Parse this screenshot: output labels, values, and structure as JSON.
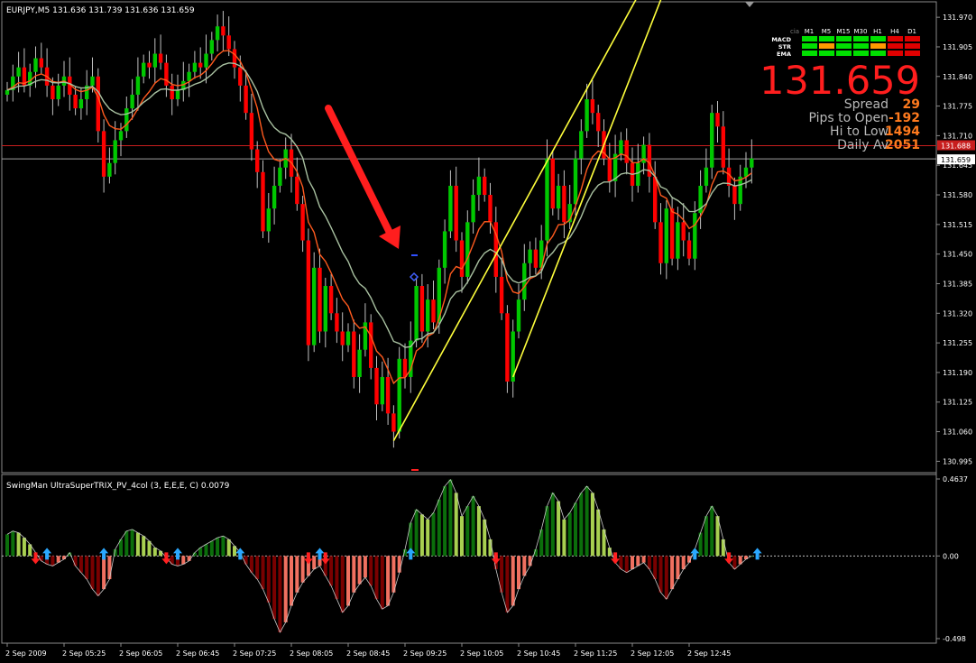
{
  "window": {
    "title": "EURJPY,M5  131.636 131.739 131.636 131.659",
    "indicator_title": "SwingMan UltraSuperTRIX_PV_4col (3, E,E,E, C) 0.0079"
  },
  "colors": {
    "bull": "#00c800",
    "bear": "#ff0000",
    "wick": "#c0c0c0",
    "ema_fast": "#ff5a1e",
    "ema_slow": "#a8c0a0",
    "channel": "#ffff3c",
    "arrow": "#ff1e1e",
    "bid_line": "#c81e1e",
    "ask_line": "#a0a0a0",
    "osc_up_strong": "#0b6e0b",
    "osc_up_weak": "#a8d050",
    "osc_dn_strong": "#7a0000",
    "osc_dn_weak": "#f07060",
    "dash_green": "#00e000",
    "dash_orange": "#ff9a00",
    "dash_red": "#e00000"
  },
  "dashboard": {
    "corner_label": "cia",
    "timeframes": [
      "M1",
      "M5",
      "M15",
      "M30",
      "H1",
      "H4",
      "D1"
    ],
    "rows": [
      {
        "name": "MACD",
        "states": [
          "green",
          "green",
          "green",
          "green",
          "green",
          "red",
          "red"
        ]
      },
      {
        "name": "STR",
        "states": [
          "green",
          "orange",
          "green",
          "green",
          "orange",
          "red",
          "red"
        ]
      },
      {
        "name": "EMA",
        "states": [
          "green",
          "green",
          "green",
          "green",
          "green",
          "red",
          "red"
        ]
      }
    ],
    "price": "131.659",
    "stats": [
      {
        "label": "Spread",
        "value": "29"
      },
      {
        "label": "Pips to Open",
        "value": "-192"
      },
      {
        "label": "Hi to Low",
        "value": "1494"
      },
      {
        "label": "Daily Av",
        "value": "2051"
      }
    ]
  },
  "chart_data": [
    {
      "type": "candlestick",
      "symbol": "EURJPY",
      "timeframe": "M5",
      "ylim": [
        130.97,
        132.0
      ],
      "yticks": [
        "131.970",
        "131.905",
        "131.840",
        "131.775",
        "131.710",
        "131.645",
        "131.580",
        "131.515",
        "131.450",
        "131.385",
        "131.320",
        "131.255",
        "131.190",
        "131.125",
        "131.060",
        "130.995"
      ],
      "bid_label": "131.688",
      "ask_label": "131.659",
      "bid": 131.688,
      "ask": 131.659,
      "channel_lines": [
        {
          "from": [
            68,
            131.04
          ],
          "to": [
            112,
            132.04
          ]
        },
        {
          "from": [
            89,
            131.18
          ],
          "to": [
            116,
            132.04
          ]
        }
      ],
      "candles": [
        [
          131.8,
          131.81
        ],
        [
          131.81,
          131.84
        ],
        [
          131.84,
          131.86
        ],
        [
          131.86,
          131.82
        ],
        [
          131.82,
          131.85
        ],
        [
          131.85,
          131.88
        ],
        [
          131.88,
          131.86
        ],
        [
          131.86,
          131.82
        ],
        [
          131.82,
          131.79
        ],
        [
          131.79,
          131.82
        ],
        [
          131.82,
          131.84
        ],
        [
          131.84,
          131.8
        ],
        [
          131.8,
          131.77
        ],
        [
          131.77,
          131.79
        ],
        [
          131.79,
          131.82
        ],
        [
          131.82,
          131.84
        ],
        [
          131.84,
          131.72
        ],
        [
          131.72,
          131.62
        ],
        [
          131.62,
          131.65
        ],
        [
          131.65,
          131.7
        ],
        [
          131.7,
          131.72
        ],
        [
          131.72,
          131.77
        ],
        [
          131.77,
          131.8
        ],
        [
          131.8,
          131.84
        ],
        [
          131.84,
          131.87
        ],
        [
          131.87,
          131.86
        ],
        [
          131.86,
          131.89
        ],
        [
          131.89,
          131.87
        ],
        [
          131.87,
          131.82
        ],
        [
          131.82,
          131.79
        ],
        [
          131.79,
          131.81
        ],
        [
          131.81,
          131.83
        ],
        [
          131.83,
          131.85
        ],
        [
          131.85,
          131.87
        ],
        [
          131.87,
          131.86
        ],
        [
          131.86,
          131.89
        ],
        [
          131.89,
          131.92
        ],
        [
          131.92,
          131.95
        ],
        [
          131.95,
          131.93
        ],
        [
          131.93,
          131.9
        ],
        [
          131.9,
          131.86
        ],
        [
          131.86,
          131.82
        ],
        [
          131.82,
          131.76
        ],
        [
          131.76,
          131.68
        ],
        [
          131.68,
          131.63
        ],
        [
          131.63,
          131.5
        ],
        [
          131.5,
          131.55
        ],
        [
          131.55,
          131.6
        ],
        [
          131.6,
          131.64
        ],
        [
          131.64,
          131.68
        ],
        [
          131.68,
          131.62
        ],
        [
          131.62,
          131.56
        ],
        [
          131.56,
          131.48
        ],
        [
          131.48,
          131.25
        ],
        [
          131.25,
          131.42
        ],
        [
          131.42,
          131.28
        ],
        [
          131.28,
          131.38
        ],
        [
          131.38,
          131.32
        ],
        [
          131.32,
          131.28
        ],
        [
          131.28,
          131.25
        ],
        [
          131.25,
          131.28
        ],
        [
          131.28,
          131.18
        ],
        [
          131.18,
          131.24
        ],
        [
          131.24,
          131.3
        ],
        [
          131.3,
          131.2
        ],
        [
          131.2,
          131.12
        ],
        [
          131.12,
          131.18
        ],
        [
          131.18,
          131.1
        ],
        [
          131.1,
          131.06
        ],
        [
          131.06,
          131.22
        ],
        [
          131.22,
          131.18
        ],
        [
          131.18,
          131.26
        ],
        [
          131.26,
          131.38
        ],
        [
          131.38,
          131.28
        ],
        [
          131.28,
          131.35
        ],
        [
          131.35,
          131.3
        ],
        [
          131.3,
          131.42
        ],
        [
          131.42,
          131.5
        ],
        [
          131.5,
          131.6
        ],
        [
          131.6,
          131.48
        ],
        [
          131.48,
          131.4
        ],
        [
          131.4,
          131.52
        ],
        [
          131.52,
          131.58
        ],
        [
          131.58,
          131.62
        ],
        [
          131.62,
          131.58
        ],
        [
          131.58,
          131.52
        ],
        [
          131.52,
          131.4
        ],
        [
          131.4,
          131.32
        ],
        [
          131.32,
          131.17
        ],
        [
          131.17,
          131.28
        ],
        [
          131.28,
          131.35
        ],
        [
          131.35,
          131.43
        ],
        [
          131.43,
          131.46
        ],
        [
          131.46,
          131.42
        ],
        [
          131.42,
          131.48
        ],
        [
          131.48,
          131.66
        ],
        [
          131.66,
          131.55
        ],
        [
          131.55,
          131.6
        ],
        [
          131.6,
          131.52
        ],
        [
          131.52,
          131.56
        ],
        [
          131.56,
          131.66
        ],
        [
          131.66,
          131.72
        ],
        [
          131.72,
          131.79
        ],
        [
          131.79,
          131.76
        ],
        [
          131.76,
          131.72
        ],
        [
          131.72,
          131.66
        ],
        [
          131.66,
          131.61
        ],
        [
          131.61,
          131.67
        ],
        [
          131.67,
          131.7
        ],
        [
          131.7,
          131.65
        ],
        [
          131.65,
          131.6
        ],
        [
          131.6,
          131.65
        ],
        [
          131.65,
          131.69
        ],
        [
          131.69,
          131.62
        ],
        [
          131.62,
          131.52
        ],
        [
          131.52,
          131.43
        ],
        [
          131.43,
          131.55
        ],
        [
          131.55,
          131.44
        ],
        [
          131.44,
          131.52
        ],
        [
          131.52,
          131.48
        ],
        [
          131.48,
          131.44
        ],
        [
          131.44,
          131.54
        ],
        [
          131.54,
          131.6
        ],
        [
          131.6,
          131.64
        ],
        [
          131.64,
          131.76
        ],
        [
          131.76,
          131.73
        ],
        [
          131.73,
          131.64
        ],
        [
          131.64,
          131.6
        ],
        [
          131.6,
          131.56
        ],
        [
          131.56,
          131.62
        ],
        [
          131.62,
          131.64
        ],
        [
          131.64,
          131.66
        ]
      ]
    },
    {
      "type": "histogram",
      "title": "SwingMan UltraSuperTRIX_PV_4col (3, E,E,E, C) 0.0079",
      "ylim": [
        -0.52,
        0.48
      ],
      "yticks": [
        "0.4637",
        "0.00",
        "-0.498"
      ],
      "values": [
        0.13,
        0.15,
        0.14,
        0.11,
        0.07,
        0.02,
        -0.03,
        -0.05,
        -0.06,
        -0.04,
        -0.02,
        0.02,
        -0.06,
        -0.1,
        -0.14,
        -0.2,
        -0.24,
        -0.2,
        -0.14,
        0.04,
        0.1,
        0.15,
        0.16,
        0.14,
        0.12,
        0.09,
        0.05,
        0.03,
        -0.01,
        -0.05,
        -0.06,
        -0.05,
        -0.03,
        0.02,
        0.05,
        0.07,
        0.09,
        0.11,
        0.12,
        0.1,
        0.06,
        0.02,
        -0.05,
        -0.1,
        -0.14,
        -0.2,
        -0.28,
        -0.38,
        -0.46,
        -0.4,
        -0.3,
        -0.22,
        -0.16,
        -0.12,
        -0.08,
        -0.06,
        -0.12,
        -0.18,
        -0.26,
        -0.34,
        -0.3,
        -0.22,
        -0.17,
        -0.13,
        -0.18,
        -0.26,
        -0.32,
        -0.3,
        -0.22,
        -0.1,
        0.04,
        0.2,
        0.28,
        0.25,
        0.22,
        0.26,
        0.34,
        0.42,
        0.46,
        0.38,
        0.24,
        0.3,
        0.36,
        0.3,
        0.22,
        0.1,
        -0.08,
        -0.22,
        -0.34,
        -0.3,
        -0.2,
        -0.12,
        -0.06,
        0.04,
        0.16,
        0.3,
        0.38,
        0.33,
        0.22,
        0.26,
        0.32,
        0.38,
        0.42,
        0.38,
        0.28,
        0.16,
        0.05,
        -0.04,
        -0.08,
        -0.1,
        -0.08,
        -0.06,
        -0.04,
        -0.08,
        -0.14,
        -0.22,
        -0.26,
        -0.2,
        -0.14,
        -0.08,
        -0.04,
        0.04,
        0.14,
        0.24,
        0.3,
        0.24,
        0.1,
        -0.04,
        -0.08,
        -0.05,
        -0.02,
        0.0
      ],
      "up_arrows": [
        7,
        17,
        30,
        41,
        55,
        71,
        121,
        132
      ],
      "down_arrows": [
        5,
        28,
        53,
        56,
        86,
        107,
        127
      ]
    }
  ],
  "xaxis": {
    "labels": [
      "2 Sep 2009",
      "2 Sep 05:25",
      "2 Sep 06:05",
      "2 Sep 06:45",
      "2 Sep 07:25",
      "2 Sep 08:05",
      "2 Sep 08:45",
      "2 Sep 09:25",
      "2 Sep 10:05",
      "2 Sep 10:45",
      "2 Sep 11:25",
      "2 Sep 12:05",
      "2 Sep 12:45"
    ],
    "label_bars": [
      0,
      10,
      20,
      30,
      40,
      50,
      60,
      70,
      80,
      90,
      100,
      110,
      120
    ]
  }
}
